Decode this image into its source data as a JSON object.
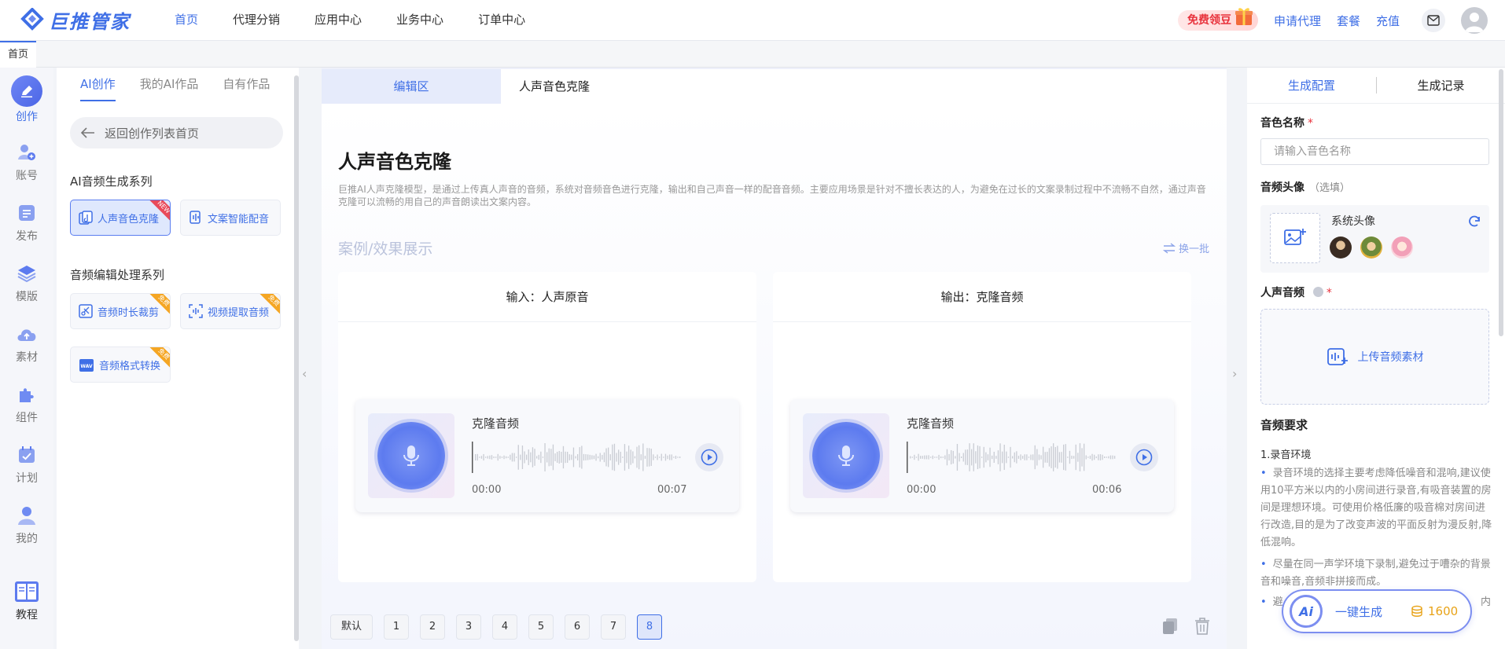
{
  "brand": {
    "name": "巨推管家",
    "color": "#3f6fe6"
  },
  "topnav": {
    "items": [
      "首页",
      "代理分销",
      "应用中心",
      "业务中心",
      "订单中心"
    ],
    "active_index": 0,
    "free_label": "免费领豆",
    "links": [
      "申请代理",
      "套餐",
      "充值"
    ],
    "mail_icon": "mail-icon",
    "avatar_icon": "user-avatar-icon"
  },
  "page_tabs": {
    "home": "首页"
  },
  "sidebar": {
    "items": [
      {
        "label": "创作",
        "icon": "pencil-icon",
        "active": true
      },
      {
        "label": "账号",
        "icon": "user-add-icon"
      },
      {
        "label": "发布",
        "icon": "publish-icon"
      },
      {
        "label": "模版",
        "icon": "layers-icon"
      },
      {
        "label": "素材",
        "icon": "cloud-icon"
      },
      {
        "label": "组件",
        "icon": "puzzle-icon"
      },
      {
        "label": "计划",
        "icon": "calendar-icon"
      },
      {
        "label": "我的",
        "icon": "person-icon"
      }
    ],
    "tutorial": {
      "label": "教程",
      "icon": "book-icon"
    }
  },
  "panel": {
    "tabs": [
      "AI创作",
      "我的AI作品",
      "自有作品"
    ],
    "back": "返回创作列表首页",
    "sections": [
      {
        "title": "AI音频生成系列",
        "tools": [
          {
            "label": "人声音色克隆",
            "active": true,
            "ribbon": "NEW"
          },
          {
            "label": "文案智能配音"
          }
        ]
      },
      {
        "title": "音频编辑处理系列",
        "tools": [
          {
            "label": "音频时长裁剪",
            "ribbon": "免费"
          },
          {
            "label": "视频提取音频",
            "ribbon": "免费"
          },
          {
            "label": "音频格式转换",
            "ribbon": "免费"
          }
        ]
      }
    ]
  },
  "editor": {
    "tabs": [
      "编辑区",
      "人声音色克隆"
    ],
    "title": "人声音色克隆",
    "description": "巨推AI人声克隆模型，是通过上传真人声音的音频，系统对音频音色进行克隆，输出和自己声音一样的配音音频。主要应用场景是针对不擅长表达的人，为避免在过长的文案录制过程中不流畅不自然，通过声音克隆可以流畅的用自己的声音朗读出文案内容。",
    "showcase_title": "案例/效果展示",
    "swap_label": "换一批",
    "cards": [
      {
        "header": "输入：人声原音",
        "audio_name": "克隆音频",
        "start": "00:00",
        "end": "00:07"
      },
      {
        "header": "输出：克隆音频",
        "audio_name": "克隆音频",
        "start": "00:00",
        "end": "00:06"
      }
    ],
    "pager": [
      "默认",
      "1",
      "2",
      "3",
      "4",
      "5",
      "6",
      "7",
      "8"
    ],
    "pager_active": 8
  },
  "config": {
    "tabs": [
      "生成配置",
      "生成记录"
    ],
    "voice_name_label": "音色名称",
    "voice_name_placeholder": "请输入音色名称",
    "avatar_label": "音频头像",
    "avatar_optional": "（选填）",
    "system_avatar": "系统头像",
    "voice_audio_label": "人声音频",
    "upload_label": "上传音频素材",
    "requirements_title": "音频要求",
    "requirement_sub": "1.录音环境",
    "bullets": [
      "录音环境的选择主要考虑降低噪音和混响,建议使用10平方米以内的小房间进行录音,有吸音装置的房间是理想环境。可使用价格低廉的吸音棉对房间进行改造,目的是为了改变声波的平面反射为漫反射,降低混响。",
      "尽量在同一声学环境下录制,避免过于嘈杂的背景音和噪音,音频非拼接而成。",
      "避"
    ],
    "bullet_tail": "内"
  },
  "generate": {
    "label": "一键生成",
    "credits": "1600",
    "badge": "Ai"
  }
}
